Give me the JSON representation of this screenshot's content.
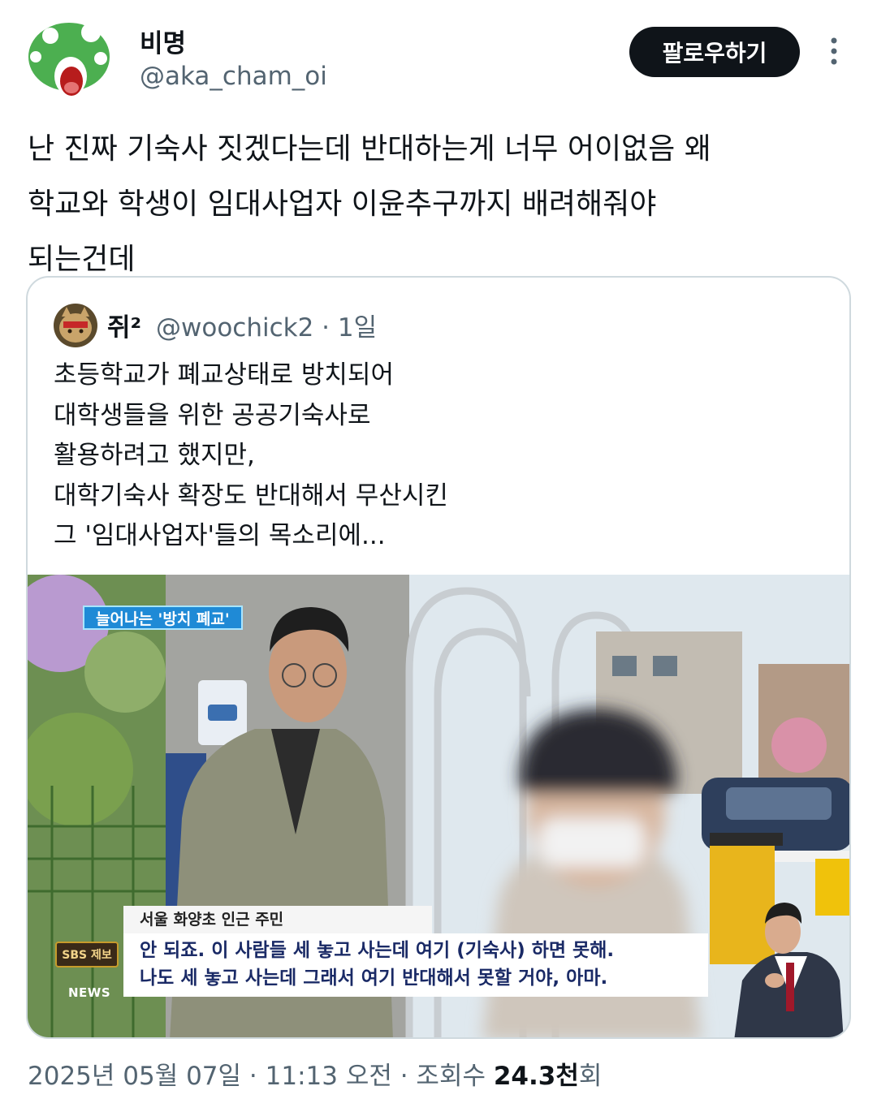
{
  "author": {
    "name": "비명",
    "handle": "@aka_cham_oi"
  },
  "follow_label": "팔로우하기",
  "tweet_text": "난 진짜 기숙사 짓겠다는데 반대하는게 너무 어이없음 왜\n학교와 학생이 임대사업자 이윤추구까지 배려해줘야\n되는건데",
  "quoted": {
    "name": "쥐²",
    "handle": "@woochick2",
    "dot": "·",
    "age": "1일",
    "text": "초등학교가 폐교상태로 방치되어\n대학생들을 위한 공공기숙사로\n활용하려고 했지만,\n대학기숙사 확장도 반대해서 무산시킨\n그 '임대사업자'들의 목소리에...",
    "media": {
      "tag": "늘어나는 '방치 폐교'",
      "caption_speaker": "서울 화양초 인근 주민",
      "caption_line1": "안 되죠. 이 사람들 세 놓고 사는데 여기 (기숙사) 하면 못해.",
      "caption_line2": "나도 세 놓고 사는데 그래서 여기 반대해서 못할 거야, 아마.",
      "badge": "SBS 제보",
      "news": "NEWS"
    }
  },
  "footer": {
    "date": "2025년 05월 07일",
    "sep1": " · ",
    "time": "11:13 오전",
    "sep2": " · ",
    "views_label": "조회수 ",
    "views_value": "24.3천",
    "views_suffix": "회"
  },
  "colors": {
    "text_primary": "#0f1419",
    "text_secondary": "#536471",
    "border": "#cfd9de",
    "button_bg": "#0f1419",
    "avatar_green": "#4caf50"
  }
}
